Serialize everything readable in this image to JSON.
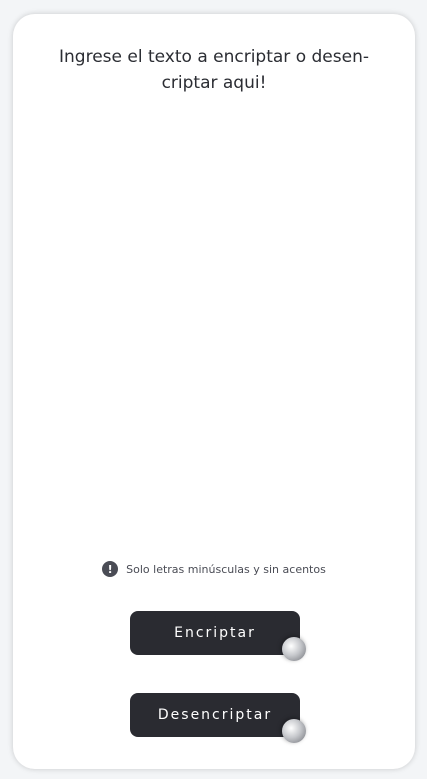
{
  "input": {
    "placeholder": "Ingrese el texto a encriptar o desen-criptar aqui!"
  },
  "notice": {
    "icon": "info-icon",
    "text": "Solo letras minúsculas y sin acentos"
  },
  "buttons": {
    "encrypt_label": "Encriptar",
    "decrypt_label": "Desencriptar"
  },
  "colors": {
    "background": "#f3f5f7",
    "card": "#ffffff",
    "button": "#2a2b31",
    "text": "#2b2d33"
  }
}
